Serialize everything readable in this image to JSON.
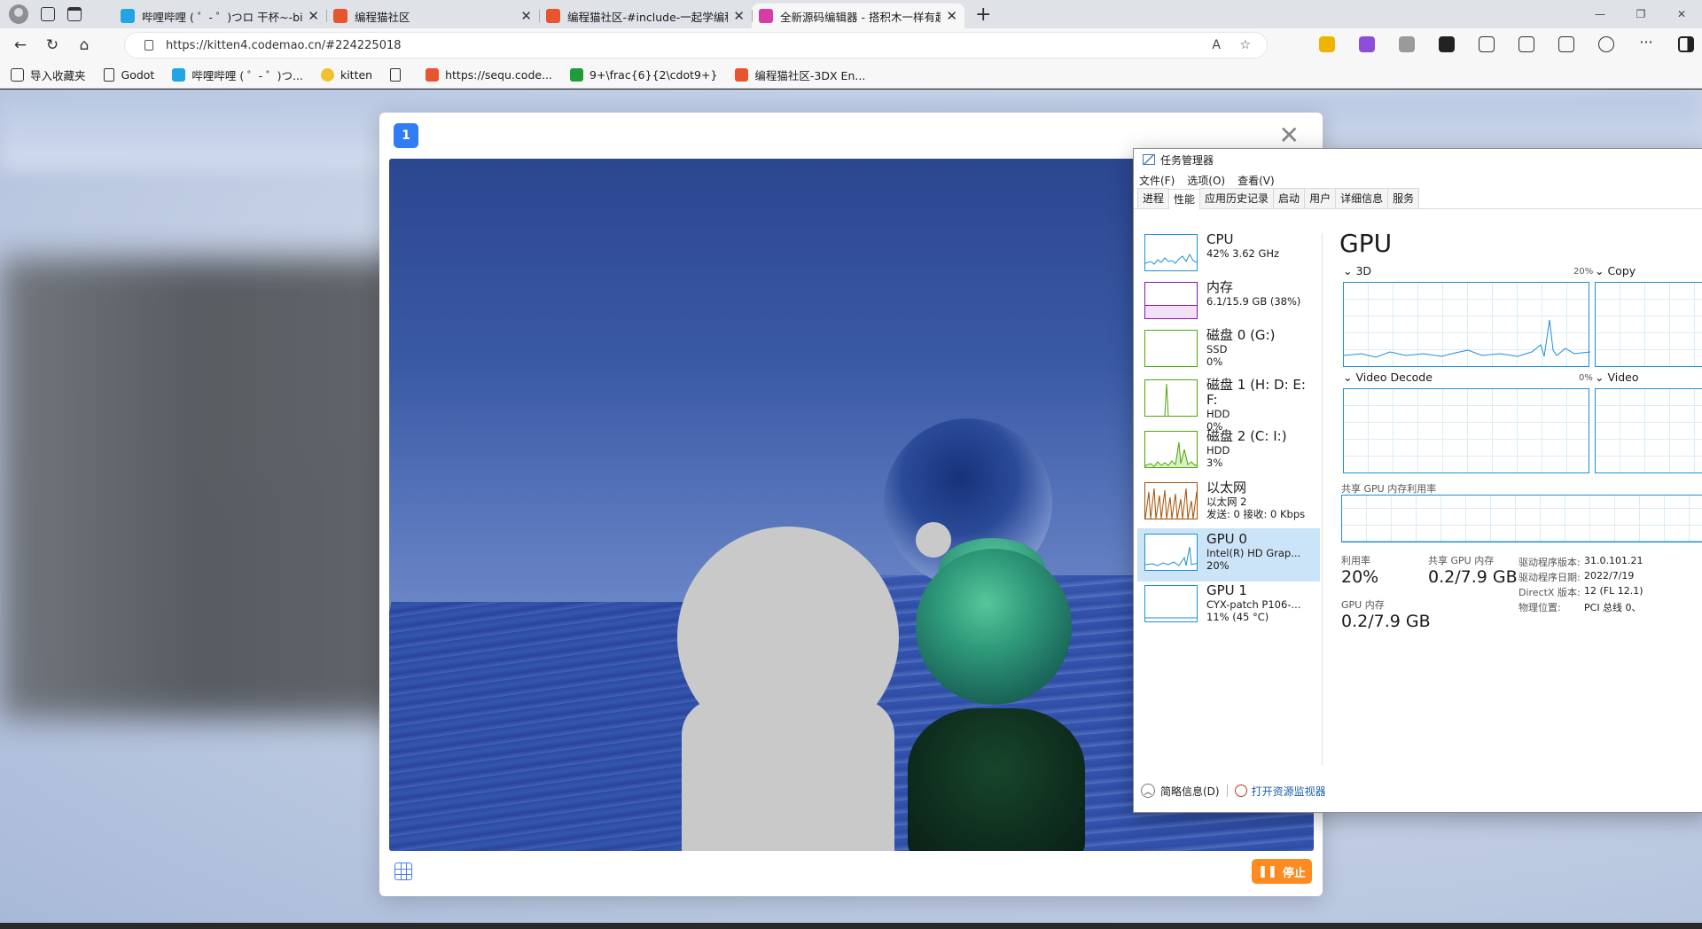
{
  "browser": {
    "tabs": [
      {
        "title": "哔哩哔哩 ( ゜- ゜)つロ 干杯~-bilibili",
        "fav_color": "#21a5e3"
      },
      {
        "title": "编程猫社区",
        "fav_color": "#e8542e"
      },
      {
        "title": "编程猫社区-#include-一起学编程",
        "fav_color": "#e8542e"
      },
      {
        "title": "全新源码编辑器 - 搭积木一样有趣",
        "fav_color": "#d63ca6"
      }
    ],
    "url": "https://kitten4.codemao.cn/#224225018",
    "bookmarks": [
      {
        "label": "导入收藏夹",
        "icon_color": "#333333"
      },
      {
        "label": "Godot",
        "icon_color": ""
      },
      {
        "label": "哔哩哔哩 ( ゜- ゜)つ...",
        "icon_color": "#21a5e3"
      },
      {
        "label": "kitten",
        "icon_color": "#f2c12e"
      },
      {
        "label": "",
        "icon_color": ""
      },
      {
        "label": "https://sequ.code...",
        "icon_color": "#e8542e"
      },
      {
        "label": "9+\\frac{6}{2\\cdot9+}",
        "icon_color": "#1f9d3a"
      },
      {
        "label": "编程猫社区-3DX En...",
        "icon_color": "#e8542e"
      }
    ]
  },
  "modal": {
    "badge": "1",
    "stop_label": "停止",
    "accent": "#2f7cf6",
    "stop_color": "#ff8a1f"
  },
  "taskmgr": {
    "title": "任务管理器",
    "menu": [
      "文件(F)",
      "选项(O)",
      "查看(V)"
    ],
    "tabs": [
      "进程",
      "性能",
      "应用历史记录",
      "启动",
      "用户",
      "详细信息",
      "服务"
    ],
    "selected_tab": "性能",
    "sidebar": [
      {
        "name": "CPU",
        "line1": "42% 3.62 GHz",
        "line2": "",
        "color": "#1e8fd6"
      },
      {
        "name": "内存",
        "line1": "6.1/15.9 GB (38%)",
        "line2": "",
        "color": "#8b12ae"
      },
      {
        "name": "磁盘 0 (G:)",
        "line1": "SSD",
        "line2": "0%",
        "color": "#4da60c"
      },
      {
        "name": "磁盘 1 (H: D: E: F:",
        "line1": "HDD",
        "line2": "0%",
        "color": "#4da60c"
      },
      {
        "name": "磁盘 2 (C: I:)",
        "line1": "HDD",
        "line2": "3%",
        "color": "#4da60c"
      },
      {
        "name": "以太网",
        "line1": "以太网 2",
        "line2": "发送: 0 接收: 0 Kbps",
        "color": "#a74f01"
      },
      {
        "name": "GPU 0",
        "line1": "Intel(R) HD Grap...",
        "line2": "20%",
        "color": "#1e8fd6"
      },
      {
        "name": "GPU 1",
        "line1": "CYX-patch P106-...",
        "line2": "11% (45 °C)",
        "color": "#1e8fd6"
      }
    ],
    "selected_item": "GPU 0",
    "main": {
      "heading": "GPU",
      "engines": [
        {
          "label": "3D",
          "pct": "20%"
        },
        {
          "label": "Copy",
          "pct": ""
        },
        {
          "label": "Video Decode",
          "pct": "0%"
        },
        {
          "label": "Video",
          "pct": ""
        }
      ],
      "shared_label": "共享 GPU 内存利用率",
      "util_label": "利用率",
      "util_value": "20%",
      "shared_mem_label": "共享 GPU 内存",
      "shared_mem_value": "0.2/7.9 GB",
      "gpu_mem_label": "GPU 内存",
      "gpu_mem_value": "0.2/7.9 GB",
      "details": [
        {
          "k": "驱动程序版本:",
          "v": "31.0.101.21"
        },
        {
          "k": "驱动程序日期:",
          "v": "2022/7/19"
        },
        {
          "k": "DirectX 版本:",
          "v": "12 (FL 12.1)"
        },
        {
          "k": "物理位置:",
          "v": "PCI 总线 0、"
        }
      ]
    },
    "footer": {
      "collapse": "简略信息(D)",
      "monitor": "打开资源监视器"
    }
  }
}
